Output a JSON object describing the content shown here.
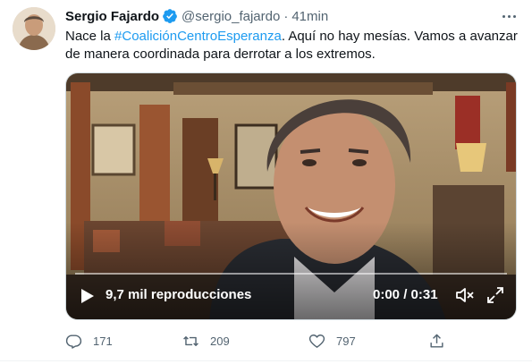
{
  "author": {
    "name": "Sergio Fajardo",
    "handle": "@sergio_fajardo",
    "separator": "·",
    "time": "41min"
  },
  "tweet": {
    "text_before": "Nace la ",
    "hashtag": "#CoaliciónCentroEsperanza",
    "text_after": ". Aquí no hay mesías. Vamos a avanzar de manera coordinada para derrotar a los extremos."
  },
  "video": {
    "views": "9,7 mil reproducciones",
    "time": "0:00 / 0:31",
    "progress": 0
  },
  "actions": {
    "replies": "171",
    "retweets": "209",
    "likes": "797"
  },
  "icons": {
    "verified": "verified-badge-icon",
    "more": "more-options-icon",
    "play": "play-icon",
    "volume": "volume-icon",
    "fullscreen": "fullscreen-icon",
    "reply": "reply-icon",
    "retweet": "retweet-icon",
    "like": "like-icon",
    "share": "share-icon"
  },
  "colors": {
    "accent": "#1d9bf0",
    "text": "#0f1419",
    "muted": "#536471"
  }
}
